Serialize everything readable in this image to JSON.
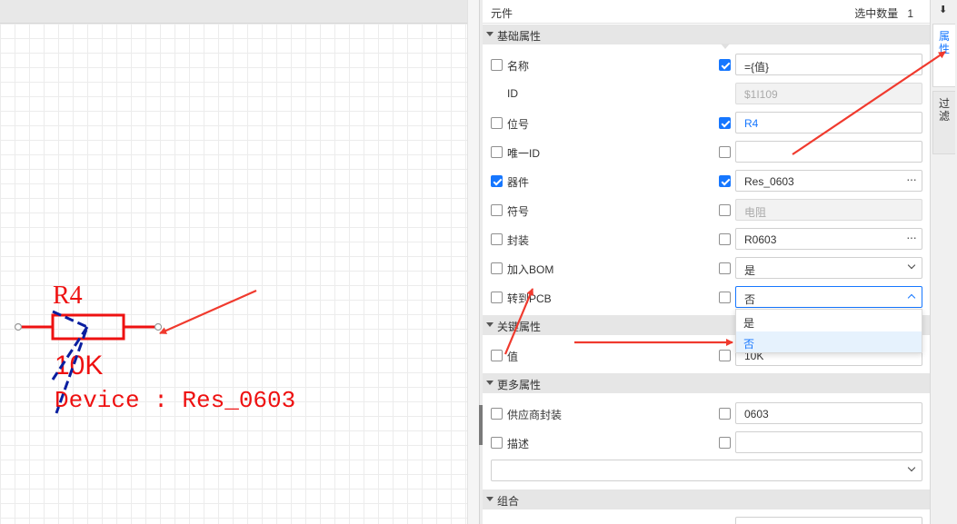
{
  "canvas": {
    "component": {
      "designator": "R4",
      "value": "10K",
      "device_line": "Device : Res_0603"
    }
  },
  "panel": {
    "title": "元件",
    "selection_label": "选中数量",
    "selection_count": "1",
    "sections": {
      "basic": "基础属性",
      "key": "关键属性",
      "more": "更多属性",
      "group": "组合"
    },
    "rows": {
      "name": {
        "label": "名称",
        "left_checked": false,
        "right_checked": true,
        "value": "={值}"
      },
      "id": {
        "label": "ID",
        "value": "$1I109"
      },
      "refdes": {
        "label": "位号",
        "left_checked": false,
        "right_checked": true,
        "value": "R4"
      },
      "uid": {
        "label": "唯一ID",
        "left_checked": false,
        "right_checked": false,
        "value": ""
      },
      "device": {
        "label": "器件",
        "left_checked": true,
        "right_checked": true,
        "value": "Res_0603"
      },
      "symbol": {
        "label": "符号",
        "left_checked": false,
        "right_checked": false,
        "value": "电阻"
      },
      "footprint": {
        "label": "封装",
        "left_checked": false,
        "right_checked": false,
        "value": "R0603"
      },
      "add_bom": {
        "label": "加入BOM",
        "left_checked": false,
        "right_checked": false,
        "value": "是"
      },
      "to_pcb": {
        "label": "转到PCB",
        "left_checked": false,
        "right_checked": false,
        "value": "否"
      },
      "value": {
        "label": "值",
        "left_checked": false,
        "right_checked": false,
        "value": "10K"
      },
      "supplier_fp": {
        "label": "供应商封装",
        "left_checked": false,
        "right_checked": false,
        "value": "0603"
      },
      "desc": {
        "label": "描述",
        "left_checked": false,
        "right_checked": false,
        "value": ""
      },
      "extra": {
        "value": ""
      }
    },
    "dropdown_options": [
      "是",
      "否"
    ],
    "dropdown_selected": "否"
  },
  "sidetabs": {
    "pin": "⬇",
    "properties": [
      "属",
      "性"
    ],
    "filter": [
      "过",
      "滤"
    ]
  },
  "colors": {
    "accent": "#1677ff",
    "resistor": "#ee1111",
    "annotation_arrow": "#f03a2e",
    "annotation_scribble": "#0a1fa0",
    "section_bg": "#e6e6e6"
  }
}
